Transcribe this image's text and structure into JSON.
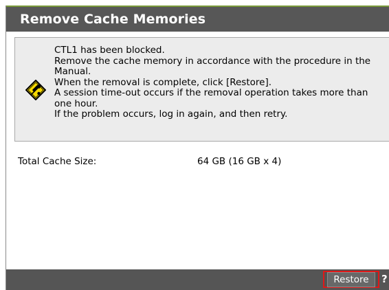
{
  "dialog": {
    "title": "Remove Cache Memories"
  },
  "message": {
    "icon": "warning-diamond-icon",
    "lines": [
      "CTL1 has been blocked.",
      "Remove the cache memory in accordance with the procedure in the",
      "Manual.",
      "When the removal is complete, click [Restore].",
      "A session time-out occurs if the removal operation takes more than",
      "one hour.",
      "If the problem occurs, log in again, and then retry."
    ]
  },
  "info": {
    "total_cache_size_label": "Total Cache Size:",
    "total_cache_size_value": "64 GB (16 GB x 4)"
  },
  "footer": {
    "restore_label": "Restore",
    "help_label": "?"
  },
  "colors": {
    "title_bar": "#575757",
    "footer": "#555555",
    "message_bg": "#ececec",
    "highlight_border": "#e01818",
    "warning_yellow": "#f5d800"
  }
}
